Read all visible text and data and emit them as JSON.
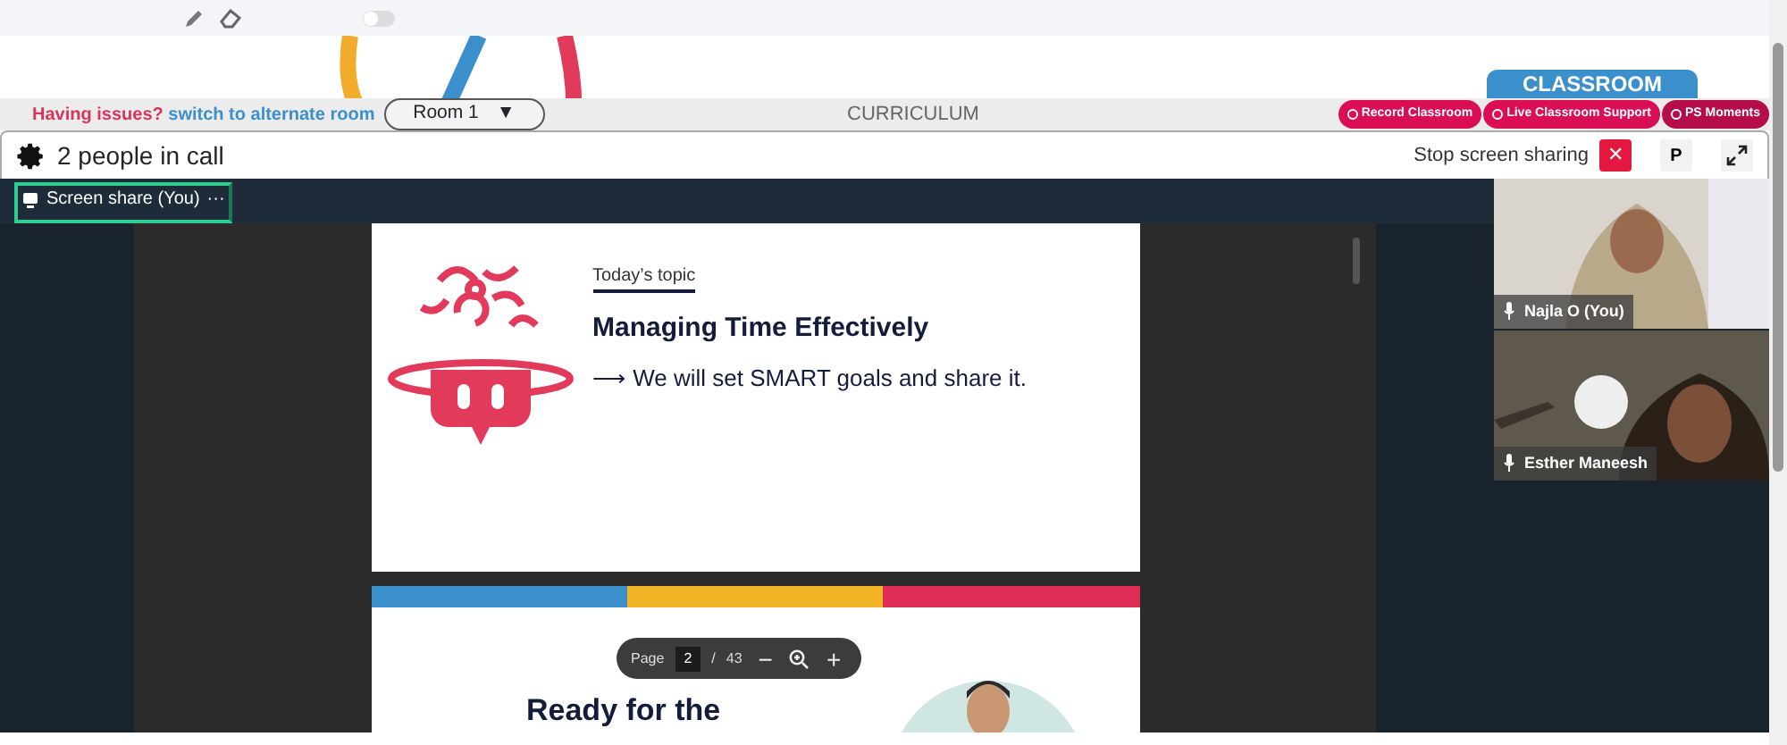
{
  "toggle": {
    "on": false
  },
  "room_bar": {
    "issue_text": "Having issues?",
    "switch_link": "switch to alternate room",
    "room_select": "Room 1",
    "room_caret": "▼",
    "center_label": "CURRICULUM",
    "classroom_tab": "CLASSROOM",
    "actions": [
      {
        "label": "Record Classroom",
        "color": "#d90e55"
      },
      {
        "label": "Live Classroom Support",
        "color": "#d90e55"
      },
      {
        "label": "PS Moments",
        "color": "#b50d4a"
      }
    ]
  },
  "call_header": {
    "title": "2 people in call",
    "stop_label": "Stop screen sharing",
    "stop_button": "✕",
    "p_button": "P"
  },
  "tabs": [
    {
      "label": "Screen share (You)",
      "more": "···",
      "selected": true
    }
  ],
  "slides": [
    {
      "kind": "topic",
      "eyebrow": "Today’s topic",
      "heading": "Managing Time Effectively",
      "arrow": "⟶",
      "line": "We will set SMART goals and share it."
    },
    {
      "kind": "ready",
      "heading": "Ready for the"
    }
  ],
  "pdf_toolbar": {
    "page_label": "Page",
    "page_value": "2",
    "separator": "/",
    "page_total": "43",
    "zoom_out": "−",
    "zoom_in": "+"
  },
  "participants": [
    {
      "name": "Najla O (You)",
      "kind": "hijab"
    },
    {
      "name": "Esther Maneesh",
      "kind": "child"
    }
  ]
}
